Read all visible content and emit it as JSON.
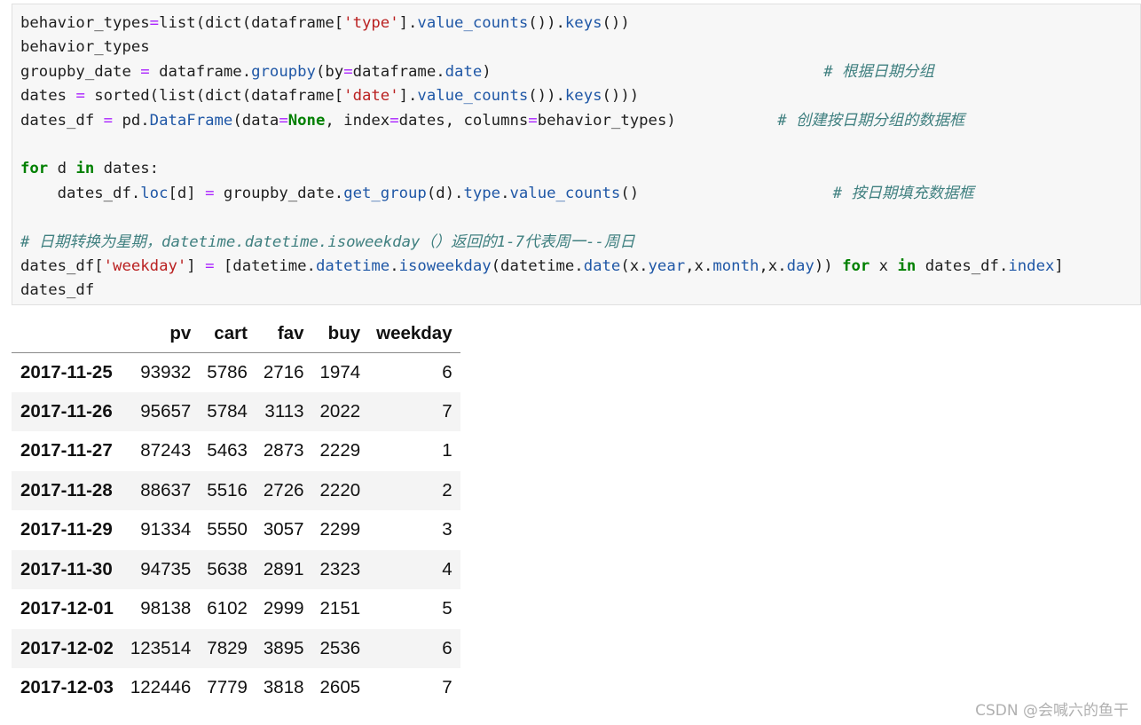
{
  "code_cell": {
    "lines": [
      [
        [
          "behavior_types",
          "var"
        ],
        [
          "=",
          "op"
        ],
        [
          "list(dict(dataframe[",
          "var"
        ],
        [
          "'type'",
          "str"
        ],
        [
          "].",
          "var"
        ],
        [
          "value_counts",
          "attr"
        ],
        [
          "()).",
          "var"
        ],
        [
          "keys",
          "attr"
        ],
        [
          "())",
          "var"
        ]
      ],
      [
        [
          "behavior_types",
          "var"
        ]
      ],
      [
        [
          "groupby_date ",
          "var"
        ],
        [
          "=",
          "op"
        ],
        [
          " dataframe.",
          "var"
        ],
        [
          "groupby",
          "attr"
        ],
        [
          "(by",
          "var"
        ],
        [
          "=",
          "op"
        ],
        [
          "dataframe.",
          "var"
        ],
        [
          "date",
          "attr"
        ],
        [
          ")",
          "var"
        ],
        [
          "                                    ",
          "var"
        ],
        [
          "# 根据日期分组",
          "cm"
        ]
      ],
      [
        [
          "dates ",
          "var"
        ],
        [
          "=",
          "op"
        ],
        [
          " sorted(list(dict(dataframe[",
          "var"
        ],
        [
          "'date'",
          "str"
        ],
        [
          "].",
          "var"
        ],
        [
          "value_counts",
          "attr"
        ],
        [
          "()).",
          "var"
        ],
        [
          "keys",
          "attr"
        ],
        [
          "()))",
          "var"
        ]
      ],
      [
        [
          "dates_df ",
          "var"
        ],
        [
          "=",
          "op"
        ],
        [
          " pd.",
          "var"
        ],
        [
          "DataFrame",
          "attr"
        ],
        [
          "(data",
          "var"
        ],
        [
          "=",
          "op"
        ],
        [
          "None",
          "kw"
        ],
        [
          ", index",
          "var"
        ],
        [
          "=",
          "op"
        ],
        [
          "dates, columns",
          "var"
        ],
        [
          "=",
          "op"
        ],
        [
          "behavior_types)",
          "var"
        ],
        [
          "           ",
          "var"
        ],
        [
          "# 创建按日期分组的数据框",
          "cm"
        ]
      ],
      [],
      [
        [
          "for",
          "kw"
        ],
        [
          " d ",
          "var"
        ],
        [
          "in",
          "kw"
        ],
        [
          " dates:",
          "var"
        ]
      ],
      [
        [
          "    dates_df.",
          "var"
        ],
        [
          "loc",
          "attr"
        ],
        [
          "[d] ",
          "var"
        ],
        [
          "=",
          "op"
        ],
        [
          " groupby_date.",
          "var"
        ],
        [
          "get_group",
          "attr"
        ],
        [
          "(d).",
          "var"
        ],
        [
          "type",
          "attr"
        ],
        [
          ".",
          "var"
        ],
        [
          "value_counts",
          "attr"
        ],
        [
          "()",
          "var"
        ],
        [
          "                     ",
          "var"
        ],
        [
          "# 按日期填充数据框",
          "cm"
        ]
      ],
      [],
      [
        [
          "# 日期转换为星期，datetime.datetime.isoweekday（）返回的1-7代表周一--周日",
          "cm"
        ]
      ],
      [
        [
          "dates_df[",
          "var"
        ],
        [
          "'weekday'",
          "str"
        ],
        [
          "] ",
          "var"
        ],
        [
          "=",
          "op"
        ],
        [
          " [datetime.",
          "var"
        ],
        [
          "datetime",
          "attr"
        ],
        [
          ".",
          "var"
        ],
        [
          "isoweekday",
          "attr"
        ],
        [
          "(datetime.",
          "var"
        ],
        [
          "date",
          "attr"
        ],
        [
          "(x.",
          "var"
        ],
        [
          "year",
          "attr"
        ],
        [
          ",x.",
          "var"
        ],
        [
          "month",
          "attr"
        ],
        [
          ",x.",
          "var"
        ],
        [
          "day",
          "attr"
        ],
        [
          ")) ",
          "var"
        ],
        [
          "for",
          "kw"
        ],
        [
          " x ",
          "var"
        ],
        [
          "in",
          "kw"
        ],
        [
          " dates_df.",
          "var"
        ],
        [
          "index",
          "attr"
        ],
        [
          "]",
          "var"
        ]
      ],
      [
        [
          "dates_df",
          "var"
        ]
      ]
    ]
  },
  "output_table": {
    "columns": [
      "",
      "pv",
      "cart",
      "fav",
      "buy",
      "weekday"
    ],
    "rows": [
      {
        "index": "2017-11-25",
        "values": [
          "93932",
          "5786",
          "2716",
          "1974",
          "6"
        ]
      },
      {
        "index": "2017-11-26",
        "values": [
          "95657",
          "5784",
          "3113",
          "2022",
          "7"
        ]
      },
      {
        "index": "2017-11-27",
        "values": [
          "87243",
          "5463",
          "2873",
          "2229",
          "1"
        ]
      },
      {
        "index": "2017-11-28",
        "values": [
          "88637",
          "5516",
          "2726",
          "2220",
          "2"
        ]
      },
      {
        "index": "2017-11-29",
        "values": [
          "91334",
          "5550",
          "3057",
          "2299",
          "3"
        ]
      },
      {
        "index": "2017-11-30",
        "values": [
          "94735",
          "5638",
          "2891",
          "2323",
          "4"
        ]
      },
      {
        "index": "2017-12-01",
        "values": [
          "98138",
          "6102",
          "2999",
          "2151",
          "5"
        ]
      },
      {
        "index": "2017-12-02",
        "values": [
          "123514",
          "7829",
          "3895",
          "2536",
          "6"
        ]
      },
      {
        "index": "2017-12-03",
        "values": [
          "122446",
          "7779",
          "3818",
          "2605",
          "7"
        ]
      }
    ]
  },
  "watermark": "CSDN @会喊六的鱼干",
  "colors": {
    "keyword": "#008000",
    "string": "#ba2121",
    "operator": "#aa22ff",
    "attribute": "#1f57a6",
    "comment": "#408080",
    "code_bg": "#f7f7f7",
    "row_stripe": "#f4f4f4"
  }
}
